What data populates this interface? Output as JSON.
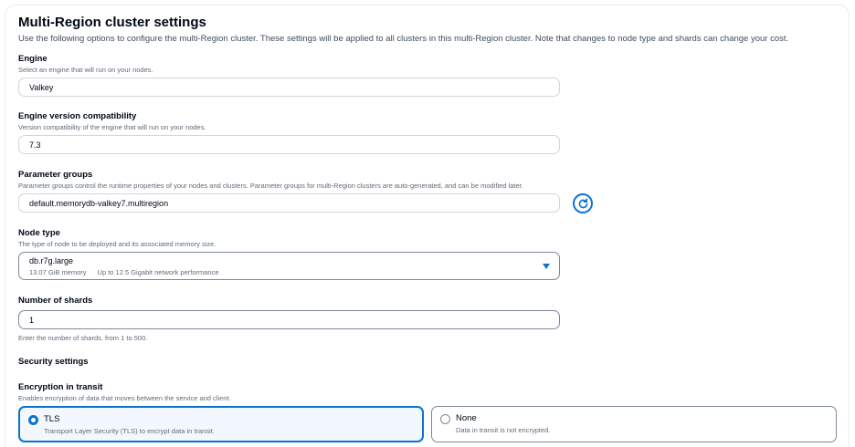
{
  "panel": {
    "title": "Multi-Region cluster settings",
    "description": "Use the following options to configure the multi-Region cluster. These settings will be applied to all clusters in this multi-Region cluster. Note that changes to node type and shards can change your cost."
  },
  "engine": {
    "label": "Engine",
    "hint": "Select an engine that will run on your nodes.",
    "value": "Valkey"
  },
  "engine_version": {
    "label": "Engine version compatibility",
    "hint": "Version compatibility of the engine that will run on your nodes.",
    "value": "7.3"
  },
  "parameter_groups": {
    "label": "Parameter groups",
    "hint": "Parameter groups control the runtime properties of your nodes and clusters. Parameter groups for multi-Region clusters are auto-generated, and can be modified later.",
    "value": "default.memorydb-valkey7.multiregion",
    "refresh_icon": "refresh-icon"
  },
  "node_type": {
    "label": "Node type",
    "hint": "The type of node to be deployed and its associated memory size.",
    "value": "db.r7g.large",
    "memory": "13.07 GiB memory",
    "network": "Up to 12.5 Gigabit network performance"
  },
  "shards": {
    "label": "Number of shards",
    "value": "1",
    "constraint": "Enter the number of shards, from 1 to 500."
  },
  "security": {
    "heading": "Security settings",
    "encryption_label": "Encryption in transit",
    "encryption_hint": "Enables encryption of data that moves between the service and client.",
    "options": [
      {
        "label": "TLS",
        "description": "Transport Layer Security (TLS) to encrypt data in transit.",
        "selected": true
      },
      {
        "label": "None",
        "description": "Data in transit is not encrypted.",
        "selected": false
      }
    ]
  },
  "colors": {
    "accent": "#0972d3",
    "selected_bg": "#f2f8fd",
    "text": "#000716",
    "muted": "#5f6b7a"
  }
}
